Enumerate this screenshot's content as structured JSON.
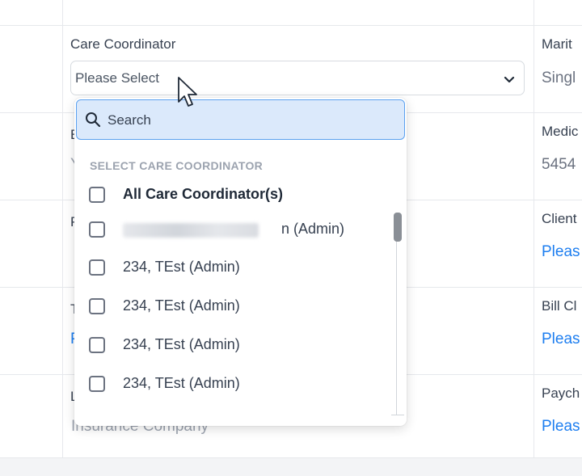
{
  "field": {
    "label": "Care Coordinator",
    "selected": "Please Select"
  },
  "right_column": {
    "row1": {
      "label": "Marit",
      "value": "Singl"
    },
    "row2": {
      "label": "Medic",
      "value": "5454"
    },
    "row3": {
      "label": "Client",
      "value": "Pleas"
    },
    "row4": {
      "label": "Bill Cl",
      "value": "Pleas"
    },
    "row5": {
      "label": "Paych",
      "value": "Pleas"
    }
  },
  "middle_column": {
    "row5_value": "Insurance Company"
  },
  "dropdown": {
    "search_placeholder": "Search",
    "section_title": "SELECT CARE COORDINATOR",
    "all_option": "All Care Coordinator(s)",
    "redacted_suffix": "n (Admin)",
    "options": [
      "234, TEst (Admin)",
      "234, TEst (Admin)",
      "234, TEst (Admin)",
      "234, TEst (Admin)"
    ]
  },
  "colors": {
    "link": "#1d7ef0",
    "search_bg": "#dbe9fb",
    "search_border": "#5aa0ef"
  }
}
